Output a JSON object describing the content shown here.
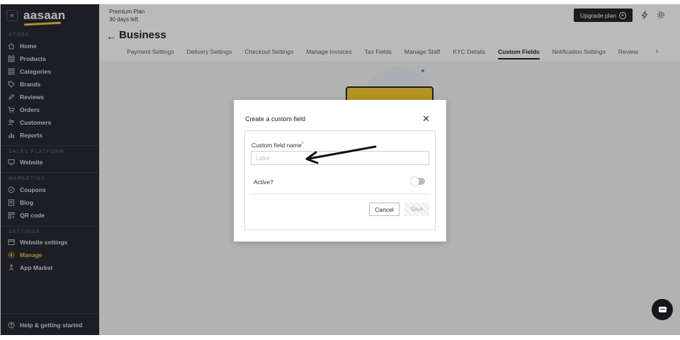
{
  "sidebar": {
    "logo": "aasaan",
    "collapse_icon": "double-chevron-left-icon",
    "sections": {
      "store": "STORE",
      "sales_platform": "SALES PLATFORM",
      "marketing": "MARKETING",
      "settings": "SETTINGS"
    },
    "store_items": [
      {
        "label": "Home",
        "icon": "home-icon"
      },
      {
        "label": "Products",
        "icon": "grid-icon"
      },
      {
        "label": "Categories",
        "icon": "grid-icon"
      },
      {
        "label": "Brands",
        "icon": "tag-icon"
      },
      {
        "label": "Reviews",
        "icon": "pen-icon"
      },
      {
        "label": "Orders",
        "icon": "cart-icon"
      },
      {
        "label": "Customers",
        "icon": "users-icon"
      },
      {
        "label": "Reports",
        "icon": "bar-chart-icon"
      }
    ],
    "sales_items": [
      {
        "label": "Website",
        "icon": "monitor-icon"
      }
    ],
    "marketing_items": [
      {
        "label": "Coupons",
        "icon": "coupon-icon"
      },
      {
        "label": "Blog",
        "icon": "document-icon"
      },
      {
        "label": "QR code",
        "icon": "qr-icon"
      }
    ],
    "settings_items": [
      {
        "label": "Website settings",
        "icon": "browser-icon"
      },
      {
        "label": "Manage",
        "icon": "gear-icon",
        "active": true
      },
      {
        "label": "App Market",
        "icon": "network-icon"
      }
    ],
    "help": {
      "label": "Help & getting started",
      "icon": "help-icon"
    }
  },
  "topbar": {
    "plan_name": "Premium Plan",
    "plan_days": "30 days left",
    "upgrade_label": "Upgrade plan",
    "icons": [
      "lightning-icon",
      "gear-icon"
    ]
  },
  "page": {
    "title": "Business",
    "tabs": [
      "Payment Settings",
      "Delivery Settings",
      "Checkout Settings",
      "Manage Invoices",
      "Tax Fields",
      "Manage Staff",
      "KYC Details",
      "Custom Fields",
      "Notification Settings",
      "Review"
    ],
    "active_tab": "Custom Fields"
  },
  "modal": {
    "title": "Create a custom field",
    "close_icon": "close-icon",
    "field_label": "Custom field name",
    "field_required_mark": "*",
    "field_placeholder": "Label",
    "field_value": "",
    "active_label": "Active?",
    "active_toggle": false,
    "cancel_label": "Cancel",
    "save_label": "Save"
  },
  "colors": {
    "sidebar_bg": "#171a23",
    "accent_active": "#e8b93a",
    "dark_button": "#15171d",
    "illustration_yellow": "#f4c81e"
  }
}
